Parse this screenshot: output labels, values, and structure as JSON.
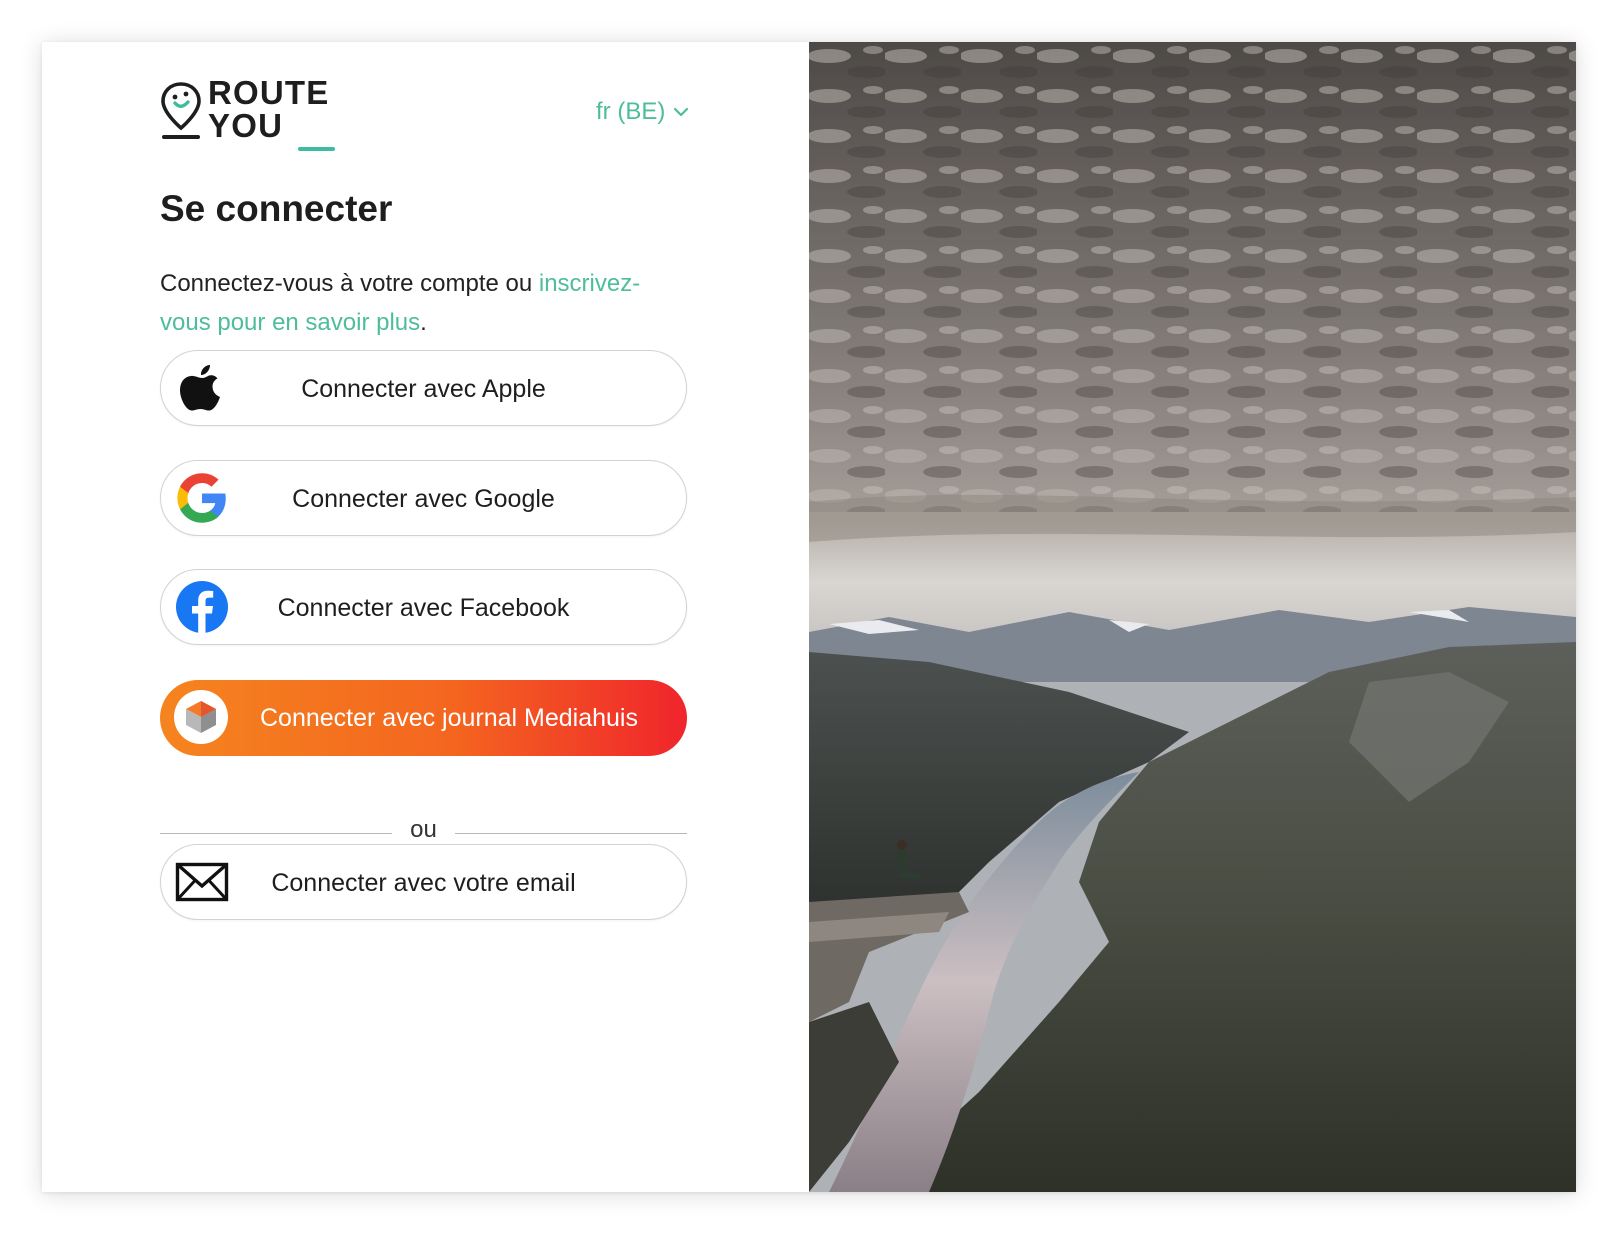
{
  "brand": {
    "line1": "ROUTE",
    "line2": "YOU"
  },
  "language": {
    "label": "fr (BE)"
  },
  "login": {
    "title": "Se connecter",
    "intro_text": "Connectez-vous à votre compte ou ",
    "signup_link": "inscrivez-vous pour en savoir plus",
    "intro_end": "."
  },
  "buttons": {
    "apple": "Connecter avec Apple",
    "google": "Connecter avec Google",
    "facebook": "Connecter avec Facebook",
    "mediahuis": "Connecter avec journal Mediahuis",
    "email": "Connecter avec votre email"
  },
  "divider": {
    "label": "ou"
  },
  "colors": {
    "accent": "#4dbd9c",
    "mediahuis_start": "#f5841f",
    "mediahuis_end": "#f0252c",
    "facebook": "#1877f2"
  },
  "icons": {
    "logo": "map-pin-logo-icon",
    "language": "chevron-down-icon",
    "apple": "apple-icon",
    "google": "google-icon",
    "facebook": "facebook-icon",
    "mediahuis": "mediahuis-icon",
    "email": "envelope-icon"
  }
}
